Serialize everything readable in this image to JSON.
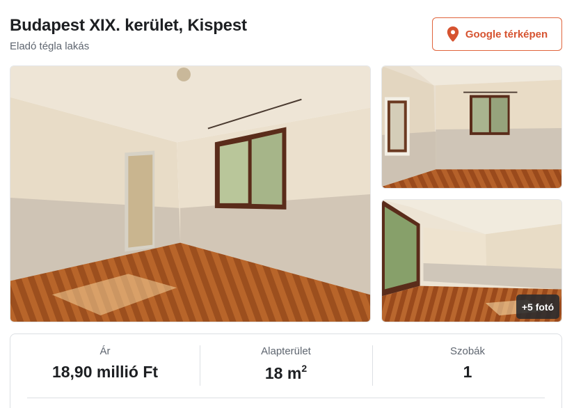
{
  "header": {
    "title": "Budapest XIX. kerület, Kispest",
    "subtitle": "Eladó tégla lakás"
  },
  "map_button": {
    "label": "Google térképen",
    "icon": "map-pin-icon",
    "accent_color": "#d65330"
  },
  "gallery": {
    "more_photos_label": "+5 fotó"
  },
  "stats": {
    "price_label": "Ár",
    "price_value": "18,90 millió Ft",
    "area_label": "Alapterület",
    "area_value": "18 m",
    "area_unit_sup": "2",
    "rooms_label": "Szobák",
    "rooms_value": "1"
  }
}
